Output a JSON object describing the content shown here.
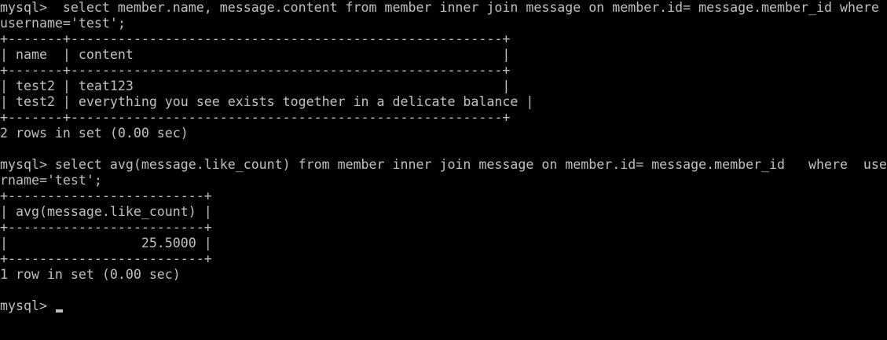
{
  "terminal": {
    "lines": [
      "mysql>  select member.name, message.content from member inner join message on member.id= message.member_id where",
      "username='test';",
      "+-------+-------------------------------------------------------+",
      "| name  | content                                               |",
      "+-------+-------------------------------------------------------+",
      "| test2 | teat123                                               |",
      "| test2 | everything you see exists together in a delicate balance |",
      "+-------+-------------------------------------------------------+",
      "2 rows in set (0.00 sec)",
      "",
      "mysql> select avg(message.like_count) from member inner join message on member.id= message.member_id   where  use",
      "rname='test';",
      "+-------------------------+",
      "| avg(message.like_count) |",
      "+-------------------------+",
      "|                 25.5000 |",
      "+-------------------------+",
      "1 row in set (0.00 sec)",
      "",
      "mysql> "
    ],
    "colors": {
      "background": "#000000",
      "text": "#c0c0c0"
    }
  }
}
